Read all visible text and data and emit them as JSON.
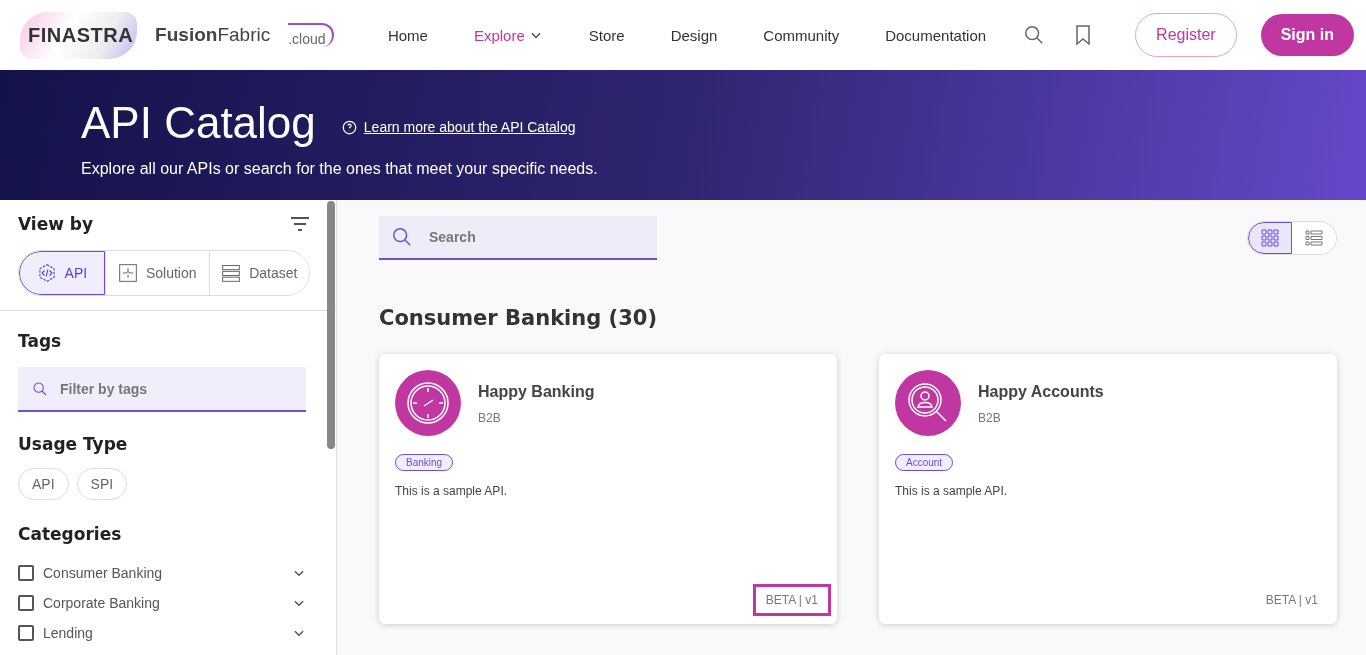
{
  "logo": {
    "brand": "FINASTRA",
    "product": "**Fusion**Fabric",
    "suffix": ".cloud"
  },
  "nav": [
    {
      "label": "Home",
      "selected": false,
      "dropdown": false
    },
    {
      "label": "Explore",
      "selected": true,
      "dropdown": true
    },
    {
      "label": "Store",
      "selected": false,
      "dropdown": false
    },
    {
      "label": "Design",
      "selected": false,
      "dropdown": false
    },
    {
      "label": "Community",
      "selected": false,
      "dropdown": false
    },
    {
      "label": "Documentation",
      "selected": false,
      "dropdown": false
    }
  ],
  "auth": {
    "register": "Register",
    "signin": "Sign in"
  },
  "hero": {
    "title": "API Catalog",
    "link": "Learn more about the API Catalog",
    "subtitle": "Explore all our APIs or search for the ones that meet your specific needs."
  },
  "sidebar": {
    "view_by": {
      "title": "View by",
      "options": [
        {
          "label": "API",
          "kind": "api",
          "selected": true
        },
        {
          "label": "Solution",
          "kind": "solution",
          "selected": false
        },
        {
          "label": "Dataset",
          "kind": "dataset",
          "selected": false
        }
      ]
    },
    "tags": {
      "title": "Tags",
      "placeholder": "Filter by tags"
    },
    "usage_type": {
      "title": "Usage Type",
      "options": [
        {
          "label": "API",
          "selected": false
        },
        {
          "label": "SPI",
          "selected": false
        }
      ]
    },
    "categories": {
      "title": "Categories",
      "items": [
        {
          "label": "Consumer Banking",
          "checked": false
        },
        {
          "label": "Corporate Banking",
          "checked": false
        },
        {
          "label": "Lending",
          "checked": false
        }
      ]
    }
  },
  "search": {
    "placeholder": "Search"
  },
  "view_toggle": [
    {
      "kind": "grid",
      "selected": true
    },
    {
      "kind": "list",
      "selected": false
    }
  ],
  "section": {
    "title": "Consumer Banking (30)"
  },
  "cards": [
    {
      "kind": "gauge",
      "title": "Happy Banking",
      "subtitle": "B2B",
      "tag": "Banking",
      "description": "This is a sample API.",
      "version": "BETA | v1",
      "highlighted": true
    },
    {
      "kind": "search-person",
      "title": "Happy Accounts",
      "subtitle": "B2B",
      "tag": "Account",
      "description": "This is a sample API.",
      "version": "BETA | v1",
      "highlighted": false
    }
  ]
}
